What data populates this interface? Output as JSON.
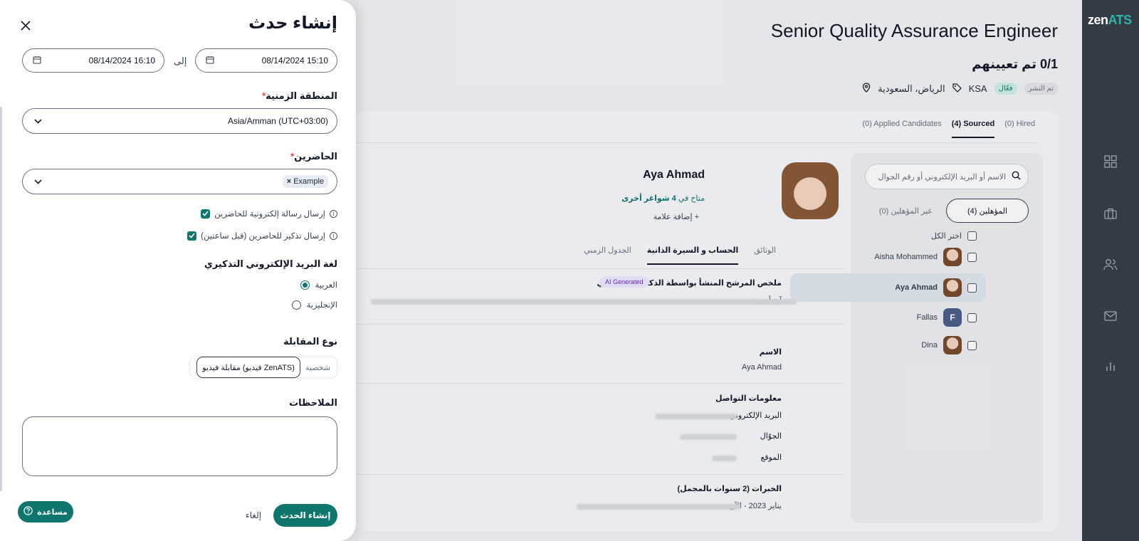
{
  "brand": {
    "logo_main": "zen",
    "logo_accent": "ATS"
  },
  "job": {
    "title": "Senior Quality Assurance Engineer",
    "hired": "0/1 تم تعيينهم",
    "location": "الرياض، السعودية",
    "tag": "KSA",
    "status_active": "فعّال",
    "status_published": "تم النشر"
  },
  "tabs": [
    {
      "label": "(0) Hired"
    },
    {
      "label": "(4) Sourced",
      "active": true
    },
    {
      "label": "(0) Applied Candidates"
    }
  ],
  "candidates_panel": {
    "search_placeholder": "الاسم أو البريد الإلكتروني أو رقم الجوال",
    "seg_qualified": "المؤهلين (4)",
    "seg_unqualified": "غير المؤهلين (0)",
    "select_all": "اختر الكل",
    "items": [
      {
        "name": "Aisha Mohammed",
        "type": "photo"
      },
      {
        "name": "Aya Ahmad",
        "type": "photo",
        "selected": true
      },
      {
        "name": "Fallas",
        "type": "letter",
        "letter": "F"
      },
      {
        "name": "Dina",
        "type": "photo"
      }
    ]
  },
  "profile": {
    "name": "Aya Ahmad",
    "availability_prefix": "متاح في ",
    "availability_count": "4",
    "availability_suffix": " شواغر أخرى",
    "add_tag": "+ إضافة علامة",
    "tabs": [
      "الجدول الزمني",
      "الحساب و السيرة الذاتية",
      "الوثائق"
    ],
    "summary_label": "ملخص المرشح المنشأ بواسطة الذكاء الاصطناعي",
    "ai_badge": "AI Generated",
    "summary_text_start": "آية أحمد",
    "name_label": "الاسم",
    "name_value": "Aya Ahmad",
    "contact_label": "معلومات التواصل",
    "email_label": "البريد الإلكتروني",
    "mobile_label": "الجوّال",
    "location_label": "الموقع",
    "experience_label": "الخبرات (2 سنوات بالمجمل)",
    "experience_date": "يناير 2023 - الآن"
  },
  "modal": {
    "title": "إنشاء حدث",
    "from_date": "08/14/2024 15:10",
    "to_label": "إلى",
    "to_date": "08/14/2024 16:10",
    "timezone_label": "المنطقة الزمنية",
    "timezone_value": "Asia/Amman (UTC+03:00)",
    "attendees_label": "الحاضرين",
    "attendee_chip": "Example",
    "send_email": "إرسال رسالة إلكترونية للحاضرين",
    "send_reminder": "إرسال تذكير للحاضرين (قبل ساعتين)",
    "reminder_lang_label": "لغة البريد الإلكتروني التذكيري",
    "lang_arabic": "العربية",
    "lang_english": "الإنجليزية",
    "interview_type_label": "نوع المقابلة",
    "type_in_person": "شخصية",
    "type_video": "مقابلة فيديو (فيديو ZenATS)",
    "notes_label": "الملاحظات",
    "notes_value": "",
    "create_button": "إنشاء الحدث",
    "cancel_button": "إلغاء"
  },
  "help_button": "مساعدة",
  "colors": {
    "primary": "#0f766e",
    "rail": "#343b45",
    "accent": "#2bb3a7"
  }
}
